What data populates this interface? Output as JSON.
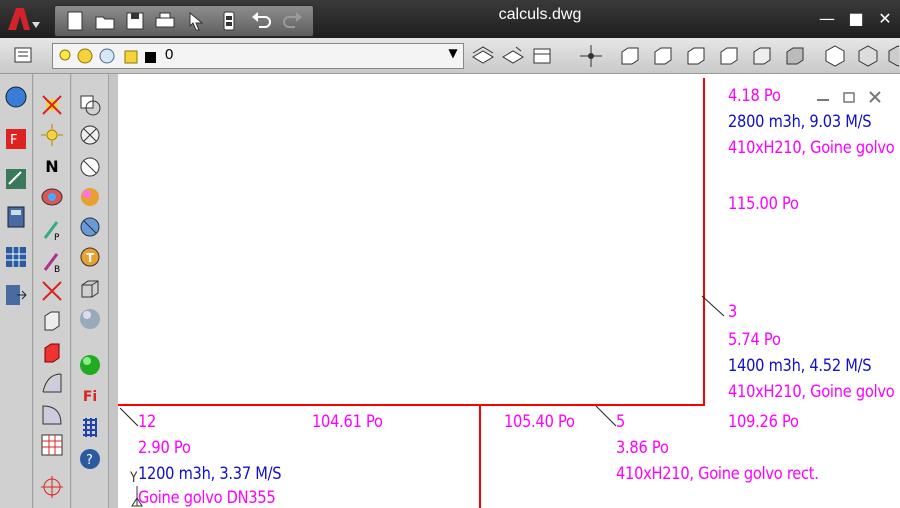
{
  "window": {
    "title": "calculs.dwg",
    "controls": {
      "minimize": "—",
      "maximize": "■",
      "close": "✕"
    }
  },
  "quick_access": [
    "new-icon",
    "open-icon",
    "save-icon",
    "print-icon",
    "match-properties-icon",
    "sheet-set-icon",
    "undo-icon",
    "redo-icon"
  ],
  "layer_toolbar": {
    "current_layer": "0",
    "dropdown_arrow": "▼"
  },
  "left_palette": {
    "col1": [
      "globe-icon",
      "render-icon",
      "tools-icon",
      "calculator-icon",
      "grid-icon",
      "export-icon"
    ],
    "col2": [
      "light-off-icon",
      "sun-icon",
      "north-icon",
      "camera-icon",
      "point-light-icon",
      "spot-light-icon",
      "light-x-icon",
      "box-icon",
      "red-box-icon",
      "surface-icon",
      "revolve-icon",
      "table-icon",
      "snap-icon"
    ],
    "col3": [
      "view-cube-icon",
      "sphere-x-icon",
      "sphere-outline-icon",
      "shaded-sphere-icon",
      "blue-sphere-icon",
      "text-sphere-icon",
      "wire-cube-icon",
      "gray-sphere-icon",
      "green-sphere-icon",
      "fi-icon",
      "grid-blue-icon",
      "help-icon"
    ],
    "labels": {
      "north": "N",
      "fi": "Fi"
    }
  },
  "drawing": {
    "viewport_controls": [
      "minimize-icon",
      "restore-icon",
      "close-icon"
    ],
    "annotations": [
      {
        "text": "4.18 Po",
        "color": "magenta"
      },
      {
        "text": "2800 m3h, 9.03 M/S",
        "color": "blue"
      },
      {
        "text": "410xH210, Goine golvo",
        "color": "magenta"
      },
      {
        "text": "115.00 Po",
        "color": "magenta"
      },
      {
        "text": "3",
        "color": "magenta"
      },
      {
        "text": "5.74 Po",
        "color": "magenta"
      },
      {
        "text": "1400 m3h, 4.52 M/S",
        "color": "blue"
      },
      {
        "text": "410xH210, Goine golvo",
        "color": "magenta"
      },
      {
        "text": "12",
        "color": "magenta"
      },
      {
        "text": "104.61 Po",
        "color": "magenta"
      },
      {
        "text": "105.40 Po",
        "color": "magenta"
      },
      {
        "text": "5",
        "color": "magenta"
      },
      {
        "text": "109.26 Po",
        "color": "magenta"
      },
      {
        "text": "2.90 Po",
        "color": "magenta"
      },
      {
        "text": "3.86 Po",
        "color": "magenta"
      },
      {
        "text": "1200 m3h, 3.37 M/S",
        "color": "blue"
      },
      {
        "text": "410xH210, Goine golvo rect.",
        "color": "magenta"
      },
      {
        "text": "Goine golvo DN355",
        "color": "magenta"
      }
    ],
    "ucs_label": "Y"
  },
  "colors": {
    "duct_line": "#ff0000",
    "magenta_text": "#ff00ff",
    "blue_text": "#1010c8"
  }
}
